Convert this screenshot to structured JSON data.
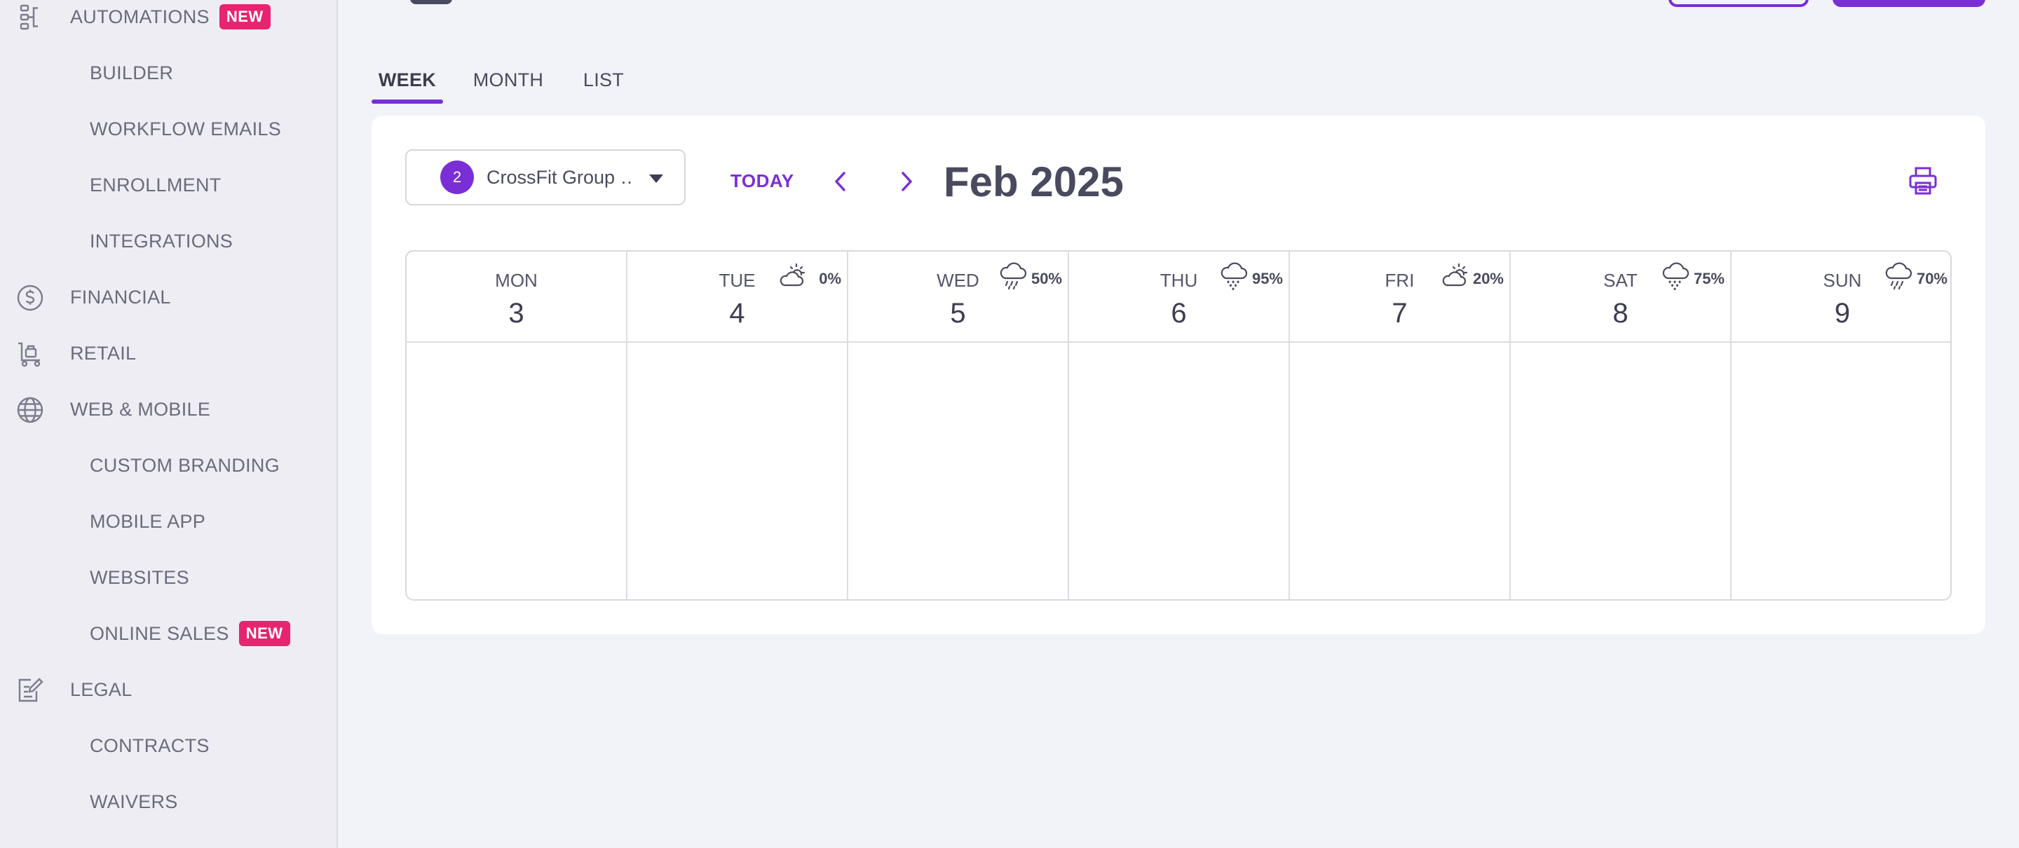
{
  "sidebar": {
    "items": [
      {
        "label": "AUTOMATIONS",
        "type": "parent",
        "icon": "automation-icon",
        "badge": "NEW"
      },
      {
        "label": "BUILDER",
        "type": "child"
      },
      {
        "label": "WORKFLOW EMAILS",
        "type": "child"
      },
      {
        "label": "ENROLLMENT",
        "type": "child"
      },
      {
        "label": "INTEGRATIONS",
        "type": "child"
      },
      {
        "label": "FINANCIAL",
        "type": "parent",
        "icon": "dollar-icon"
      },
      {
        "label": "RETAIL",
        "type": "parent",
        "icon": "cart-icon"
      },
      {
        "label": "WEB & MOBILE",
        "type": "parent",
        "icon": "globe-icon"
      },
      {
        "label": "CUSTOM BRANDING",
        "type": "child"
      },
      {
        "label": "MOBILE APP",
        "type": "child"
      },
      {
        "label": "WEBSITES",
        "type": "child"
      },
      {
        "label": "ONLINE SALES",
        "type": "child",
        "badge": "NEW"
      },
      {
        "label": "LEGAL",
        "type": "parent",
        "icon": "edit-document-icon"
      },
      {
        "label": "CONTRACTS",
        "type": "child"
      },
      {
        "label": "WAIVERS",
        "type": "child"
      }
    ],
    "badge_color": "#e8236f"
  },
  "tabs": [
    {
      "label": "WEEK",
      "active": true
    },
    {
      "label": "MONTH",
      "active": false
    },
    {
      "label": "LIST",
      "active": false
    }
  ],
  "calendar": {
    "selector": {
      "count": "2",
      "label": "CrossFit Group …"
    },
    "today_label": "TODAY",
    "month_label": "Feb 2025",
    "days": [
      {
        "name": "MON",
        "num": "3",
        "weather": null,
        "pct": ""
      },
      {
        "name": "TUE",
        "num": "4",
        "weather": "partly-sunny-icon",
        "pct": "0%"
      },
      {
        "name": "WED",
        "num": "5",
        "weather": "rain-cloud-icon",
        "pct": "50%"
      },
      {
        "name": "THU",
        "num": "6",
        "weather": "snow-cloud-icon",
        "pct": "95%"
      },
      {
        "name": "FRI",
        "num": "7",
        "weather": "partly-sunny-icon",
        "pct": "20%"
      },
      {
        "name": "SAT",
        "num": "8",
        "weather": "snow-cloud-icon",
        "pct": "75%"
      },
      {
        "name": "SUN",
        "num": "9",
        "weather": "rain-cloud-icon",
        "pct": "70%"
      }
    ]
  },
  "colors": {
    "accent": "#7a2ed6",
    "background": "#f2f3f8",
    "sidebar": "#ededf3"
  }
}
